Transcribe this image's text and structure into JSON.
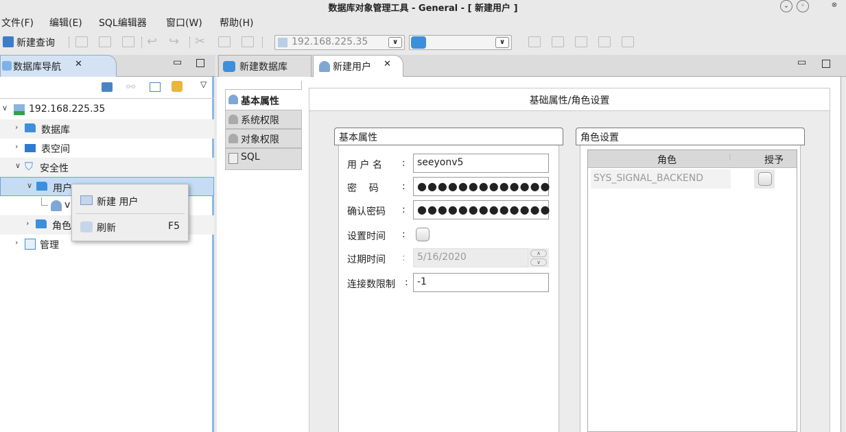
{
  "window": {
    "title": "数据库对象管理工具 - General - [ 新建用户 ]"
  },
  "menu": {
    "items": [
      "文件(F)",
      "编辑(E)",
      "SQL编辑器",
      "窗口(W)",
      "帮助(H)"
    ]
  },
  "toolbar": {
    "new_query": "新建查询",
    "server_combo": "192.168.225.35",
    "db_combo": ""
  },
  "nav": {
    "tab_title": "数据库导航",
    "tree": {
      "server": "192.168.225.35",
      "database": "数据库",
      "tablespace": "表空间",
      "security": "安全性",
      "users": "用户",
      "user_child": "v",
      "roles": "角色",
      "management": "管理"
    }
  },
  "context_menu": {
    "new_user": "新建 用户",
    "refresh": "刷新",
    "refresh_key": "F5"
  },
  "editor": {
    "tabs": [
      "新建数据库",
      "新建用户"
    ],
    "side_tabs": [
      "基本属性",
      "系统权限",
      "对象权限",
      "SQL"
    ],
    "section_title": "基础属性/角色设置",
    "basic_group": "基本属性",
    "role_group": "角色设置",
    "fields": {
      "username_label": "用 户 名",
      "username_value": "seeyonv5",
      "password_label": "密    码",
      "password_value": "●●●●●●●●●●●●●",
      "confirm_label": "确认密码",
      "confirm_value": "●●●●●●●●●●●●●",
      "settime_label": "设置时间",
      "expire_label": "过期时间",
      "expire_value": "5/16/2020",
      "connlimit_label": "连接数限制",
      "connlimit_value": "-1"
    },
    "role_table": {
      "col_role": "角色",
      "col_grant": "授予",
      "rows": [
        {
          "role": "SYS_SIGNAL_BACKEND",
          "granted": false
        }
      ]
    }
  }
}
